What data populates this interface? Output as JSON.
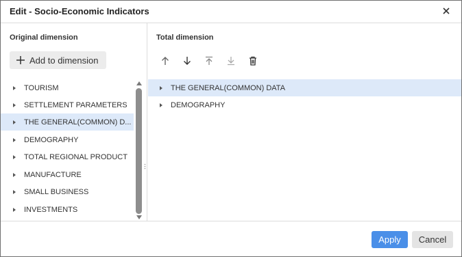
{
  "dialog": {
    "title": "Edit - Socio-Economic Indicators",
    "close_icon": "close-icon"
  },
  "left": {
    "section_label": "Original dimension",
    "add_button_label": "Add to dimension",
    "items": [
      {
        "label": "TOURISM",
        "selected": false
      },
      {
        "label": "SETTLEMENT PARAMETERS",
        "selected": false
      },
      {
        "label": "THE GENERAL(COMMON) D...",
        "selected": true
      },
      {
        "label": "DEMOGRAPHY",
        "selected": false
      },
      {
        "label": "TOTAL REGIONAL PRODUCT",
        "selected": false
      },
      {
        "label": "MANUFACTURE",
        "selected": false
      },
      {
        "label": "SMALL BUSINESS",
        "selected": false
      },
      {
        "label": "INVESTMENTS",
        "selected": false
      }
    ]
  },
  "right": {
    "section_label": "Total dimension",
    "toolbar": [
      "move-up-icon",
      "move-down-icon",
      "move-to-top-icon",
      "move-to-bottom-icon",
      "delete-icon"
    ],
    "items": [
      {
        "label": "THE GENERAL(COMMON) DATA",
        "selected": true
      },
      {
        "label": "DEMOGRAPHY",
        "selected": false
      }
    ]
  },
  "footer": {
    "apply_label": "Apply",
    "cancel_label": "Cancel"
  },
  "colors": {
    "accent": "#4a8fe8",
    "selection": "#dde9f9"
  }
}
